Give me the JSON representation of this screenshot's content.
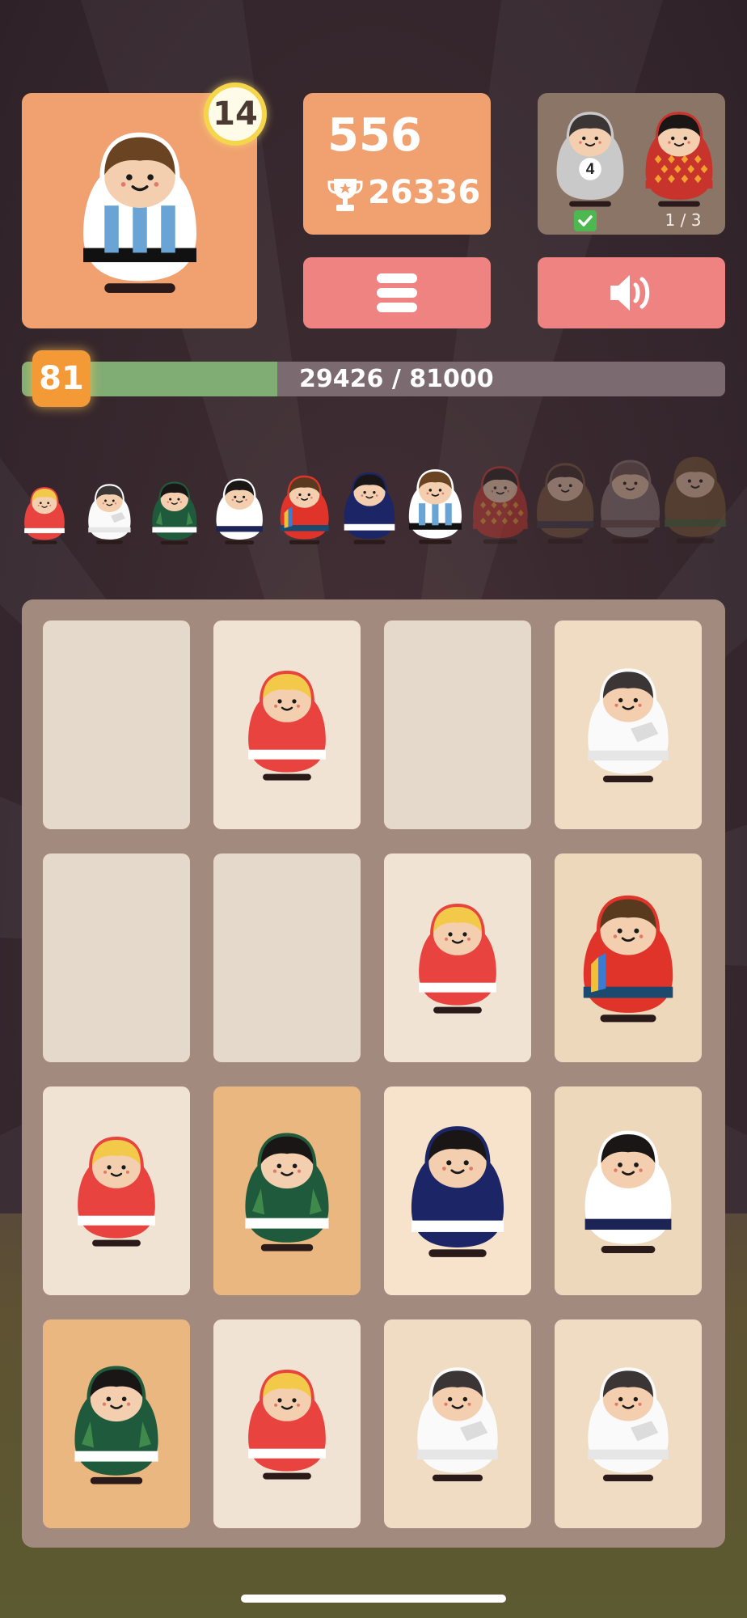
{
  "hud": {
    "hero_level": "14",
    "score": "556",
    "best_score": "26336",
    "goal": {
      "doll_number": "4",
      "progress": "1 / 3",
      "completed_first": true
    }
  },
  "progress": {
    "level": "81",
    "text": "29426 / 81000",
    "current": 29426,
    "total": 81000
  },
  "colors": {
    "orange_card": "#f0a16f",
    "pink_button": "#ef8381",
    "progress_fill": "#80ad74",
    "board": "#a38a7f"
  },
  "collection": [
    {
      "style": "red-blonde",
      "unlocked": true
    },
    {
      "style": "white-grey",
      "unlocked": true
    },
    {
      "style": "green-black",
      "unlocked": true
    },
    {
      "style": "white-navy",
      "unlocked": true
    },
    {
      "style": "red-stripes-brown",
      "unlocked": true
    },
    {
      "style": "navy-black",
      "unlocked": true
    },
    {
      "style": "argentina-brown",
      "unlocked": true
    },
    {
      "style": "red-diamonds",
      "unlocked": false
    },
    {
      "style": "tan-locked",
      "unlocked": false
    },
    {
      "style": "grey-locked",
      "unlocked": false
    },
    {
      "style": "brown-locked",
      "unlocked": false
    }
  ],
  "board": [
    [
      {
        "empty": true
      },
      {
        "style": "red-blonde",
        "tier": 1
      },
      {
        "empty": true
      },
      {
        "style": "white-grey",
        "tier": 2
      }
    ],
    [
      {
        "empty": true
      },
      {
        "empty": true
      },
      {
        "style": "red-blonde",
        "tier": 1
      },
      {
        "style": "red-stripes-brown",
        "tier": 5
      }
    ],
    [
      {
        "style": "red-blonde",
        "tier": 1
      },
      {
        "style": "green-black",
        "tier": 3
      },
      {
        "style": "navy-black",
        "tier": 6
      },
      {
        "style": "white-navy",
        "tier": 4
      }
    ],
    [
      {
        "style": "green-black",
        "tier": 3
      },
      {
        "style": "red-blonde",
        "tier": 1
      },
      {
        "style": "white-grey",
        "tier": 2
      },
      {
        "style": "white-grey",
        "tier": 2
      }
    ]
  ],
  "icons": {
    "menu": "hamburger-icon",
    "sound": "speaker-icon",
    "trophy": "trophy-icon",
    "check": "check-icon"
  }
}
